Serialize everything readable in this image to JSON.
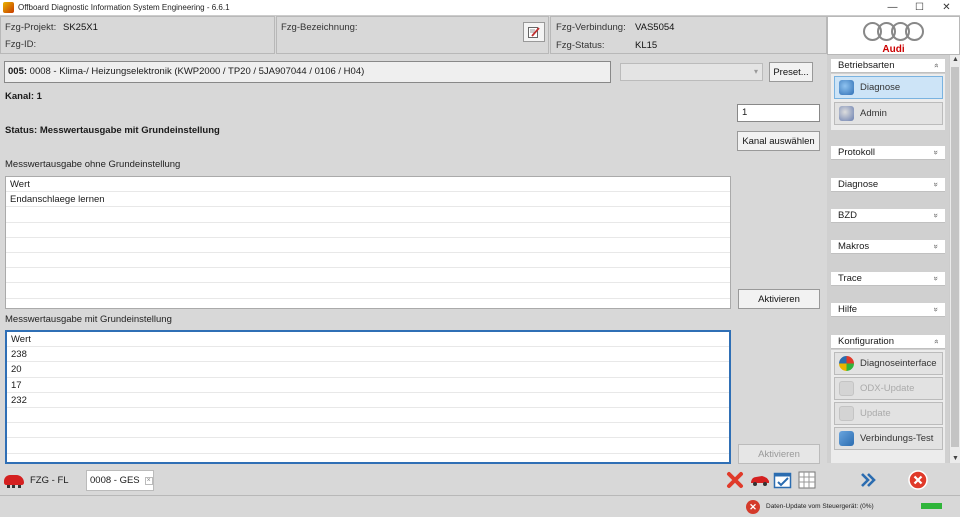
{
  "window": {
    "title": "Offboard Diagnostic Information System Engineering - 6.6.1",
    "minimize": "—",
    "maximize": "☐",
    "close": "✕"
  },
  "header": {
    "projekt_label": "Fzg-Projekt:",
    "projekt_value": "SK25X1",
    "id_label": "Fzg-ID:",
    "bezeichnung_label": "Fzg-Bezeichnung:",
    "verbindung_label": "Fzg-Verbindung:",
    "verbindung_value": "VAS5054",
    "status_label": "Fzg-Status:",
    "status_value": "KL15",
    "brand": "Audi"
  },
  "main": {
    "control_unit_prefix": "005:",
    "control_unit_text": "0008 - Klima-/ Heizungselektronik  (KWP2000 / TP20 / 5JA907044   / 0106 / H04)",
    "preset_label": "Preset...",
    "kanal_text": "Kanal:  1",
    "kanal_input_value": "1",
    "kanal_button": "Kanal auswählen",
    "status_text": "Status: Messwertausgabe mit Grundeinstellung",
    "section1": {
      "label": "Messwertausgabe ohne Grundeinstellung",
      "rows": [
        "Wert",
        "Endanschlaege lernen",
        "",
        "",
        "",
        "",
        "",
        "",
        ""
      ],
      "button": "Aktivieren"
    },
    "section2": {
      "label": "Messwertausgabe mit Grundeinstellung",
      "rows": [
        "Wert",
        "238",
        "20",
        "17",
        "232",
        "",
        "",
        "",
        ""
      ],
      "button": "Aktivieren"
    }
  },
  "bottom": {
    "tab_fzg": "FZG - FL",
    "tab_ges": "0008 - GES",
    "tab_close": "×"
  },
  "sidebar": {
    "betriebsarten": "Betriebsarten",
    "diagnose_item": "Diagnose",
    "admin_item": "Admin",
    "protokoll": "Protokoll",
    "diagnose": "Diagnose",
    "bzd": "BZD",
    "makros": "Makros",
    "trace": "Trace",
    "hilfe": "Hilfe",
    "konfiguration": "Konfiguration",
    "diagnoseinterface": "Diagnoseinterface",
    "odx_update": "ODX-Update",
    "update": "Update",
    "verbindungs_test": "Verbindungs-Test",
    "chev_up": "»",
    "chev_down": "»"
  },
  "statusbar": {
    "message": "Daten-Update vom Steuergerät: (0%)",
    "progress": 1.0
  }
}
